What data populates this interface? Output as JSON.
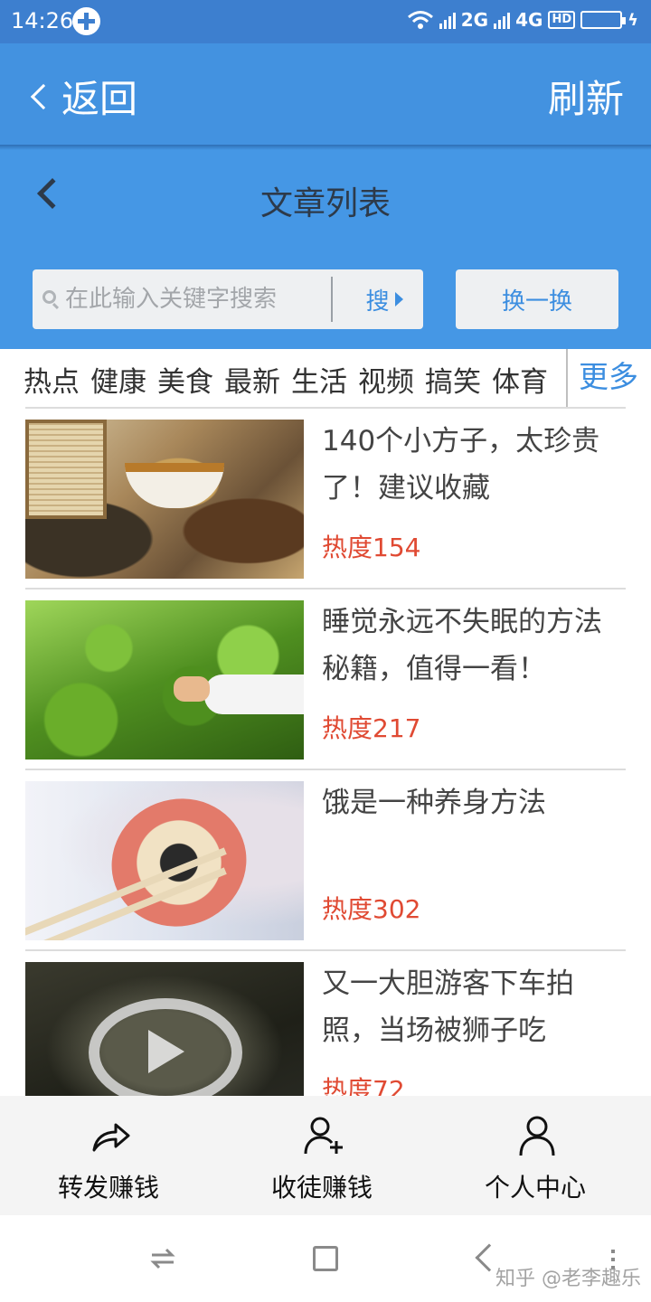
{
  "status_bar": {
    "time": "14:26",
    "network_2g": "2G",
    "network_4g": "4G",
    "hd": "HD",
    "battery_level": 1.0
  },
  "nav_bar": {
    "back_label": "返回",
    "refresh_label": "刷新"
  },
  "header": {
    "title": "文章列表"
  },
  "search": {
    "placeholder": "在此输入关键字搜索",
    "value": "",
    "button_label": "搜",
    "swap_label": "换一换"
  },
  "categories": {
    "items": [
      "热点",
      "健康",
      "美食",
      "最新",
      "生活",
      "视频",
      "搞笑",
      "体育"
    ],
    "more_label": "更多"
  },
  "articles": [
    {
      "title": "140个小方子，太珍贵了！建议收藏",
      "heat": "热度154"
    },
    {
      "title": "睡觉永远不失眠的方法秘籍，值得一看！",
      "heat": "热度217"
    },
    {
      "title": "饿是一种养身方法",
      "heat": "热度302"
    },
    {
      "title": "又一大胆游客下车拍照，当场被狮子吃",
      "heat": "热度72"
    }
  ],
  "bottom_tabs": [
    {
      "label": "转发赚钱",
      "icon": "share-icon"
    },
    {
      "label": "收徒赚钱",
      "icon": "add-user-icon"
    },
    {
      "label": "个人中心",
      "icon": "user-icon"
    }
  ],
  "watermark": "知乎 @老李趣乐",
  "colors": {
    "status_bar": "#3d7fcf",
    "nav_bar": "#4392e0",
    "header": "#4597e5",
    "accent": "#3c8ee0",
    "heat": "#e04a33"
  }
}
